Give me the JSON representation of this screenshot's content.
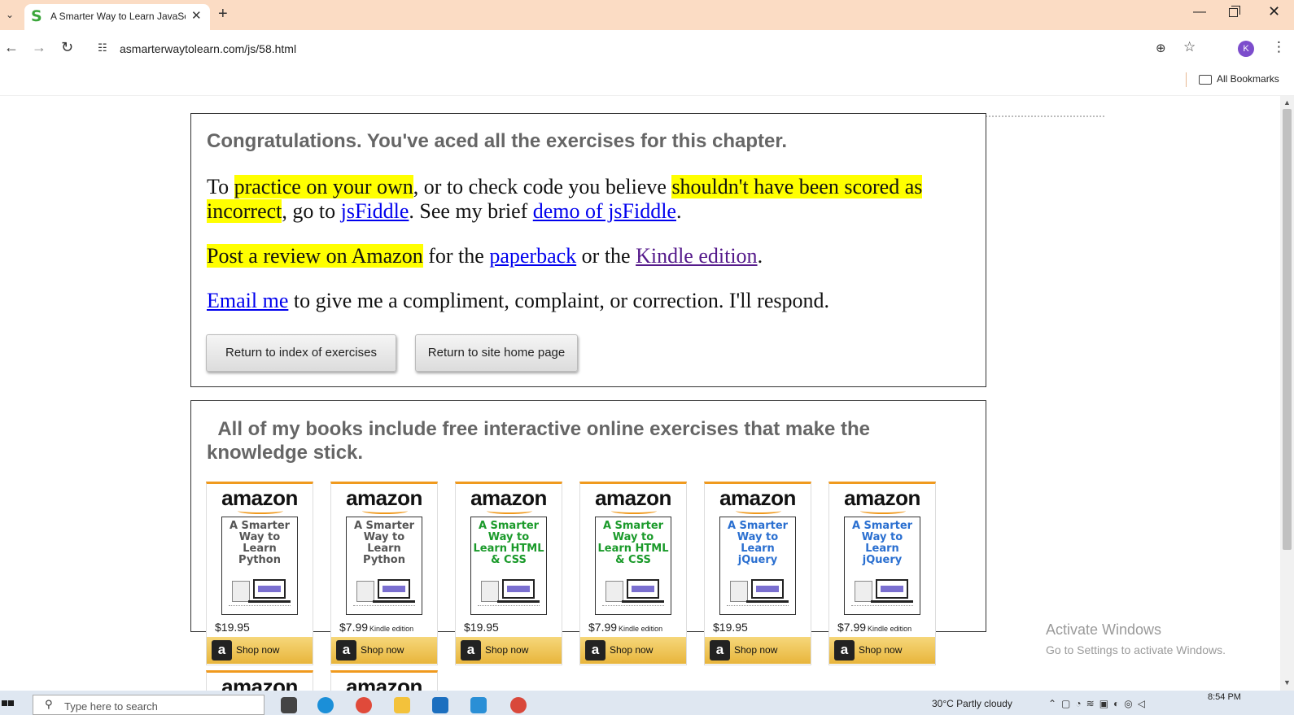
{
  "browser": {
    "tab_title": "A Smarter Way to Learn JavaScript",
    "favicon_letter": "S",
    "url": "asmarterwaytolearn.com/js/58.html",
    "profile_initial": "K",
    "bookmarks_label": "All Bookmarks"
  },
  "page": {
    "congrats": "Congratulations. You've aced all the exercises for this chapter.",
    "p1": {
      "t1": "To ",
      "hl1": "practice on your own",
      "t2": ", or to check code you believe ",
      "hl2": "shouldn't have been scored as incorrect",
      "t3": ", go to ",
      "link1": "jsFiddle",
      "t4": ". See my brief ",
      "link2": "demo of jsFiddle",
      "t5": "."
    },
    "p2": {
      "hl": "Post a review on Amazon",
      "t1": " for the ",
      "link1": "paperback",
      "t2": " or the ",
      "link2": "Kindle edition",
      "t3": "."
    },
    "p3": {
      "link": "Email me",
      "t1": " to give me a compliment, complaint, or correction. I'll respond."
    },
    "buttons": {
      "index": "Return to index of exercises",
      "home": "Return to site home page"
    },
    "books_heading": "  All of my books include free interactive online exercises that make the knowledge stick.",
    "amazon_logo": "amazon",
    "shop_label": "Shop now",
    "books": [
      {
        "title": "A Smarter Way to Learn Python",
        "price": "$19.95",
        "edition": "",
        "color": "#555555"
      },
      {
        "title": "A Smarter Way to Learn Python",
        "price": "$7.99",
        "edition": "Kindle edition",
        "color": "#555555"
      },
      {
        "title": "A Smarter Way to Learn HTML & CSS",
        "price": "$19.95",
        "edition": "",
        "color": "#1a9a2a"
      },
      {
        "title": "A Smarter Way to Learn HTML & CSS",
        "price": "$7.99",
        "edition": "Kindle edition",
        "color": "#1a9a2a"
      },
      {
        "title": "A Smarter Way to Learn jQuery",
        "price": "$19.95",
        "edition": "",
        "color": "#2a6fd0"
      },
      {
        "title": "A Smarter Way to Learn jQuery",
        "price": "$7.99",
        "edition": "Kindle edition",
        "color": "#2a6fd0"
      }
    ]
  },
  "overlay": {
    "activate_title": "Activate Windows",
    "activate_sub": "Go to Settings to activate Windows."
  },
  "taskbar": {
    "search_placeholder": "Type here to search",
    "weather": "30°C  Partly cloudy",
    "time": "8:54 PM"
  }
}
